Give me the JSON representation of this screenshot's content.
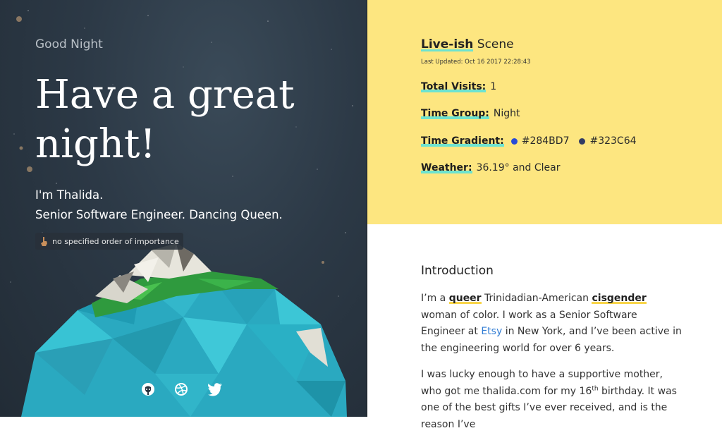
{
  "hero": {
    "greeting": "Good Night",
    "headline": "Have a great night!",
    "intro_line1": "I'm Thalida.",
    "intro_line2": "Senior Software Engineer. Dancing Queen.",
    "note": "no specified order of importance",
    "socials": [
      {
        "name": "github",
        "icon": "github-icon"
      },
      {
        "name": "dribbble",
        "icon": "dribbble-icon"
      },
      {
        "name": "twitter",
        "icon": "twitter-icon"
      }
    ]
  },
  "scene": {
    "title_bold": "Live-ish",
    "title_rest": " Scene",
    "last_updated": "Last Updated: Oct 16 2017 22:28:43",
    "total_visits_label": "Total Visits:",
    "total_visits_value": "1",
    "time_group_label": "Time Group:",
    "time_group_value": "Night",
    "time_gradient_label": "Time Gradient:",
    "gradient_color_1": "#284BD7",
    "gradient_color_2": "#323C64",
    "weather_label": "Weather:",
    "weather_value": "36.19° and Clear"
  },
  "content": {
    "heading": "Introduction",
    "p1_a": "I’m a ",
    "p1_queer": "queer",
    "p1_b": " Trinidadian-American ",
    "p1_cis": "cisgender",
    "p1_c": " woman of color. I work as a Senior Software Engineer at ",
    "p1_etsy": "Etsy",
    "p1_d": " in New York, and I’ve been active in the engineering world for over 6 years.",
    "p2_a": "I was lucky enough to have a supportive mother, who got me thalida.com for my 16",
    "p2_sup": "th",
    "p2_b": " birthday. It was one of the best gifts I’ve ever received, and is the reason I’ve"
  },
  "colors": {
    "scene_bg": "#FDE680",
    "key_highlight": "#6DE3D0",
    "word_highlight": "#F8D549",
    "link": "#2F7BD3"
  }
}
